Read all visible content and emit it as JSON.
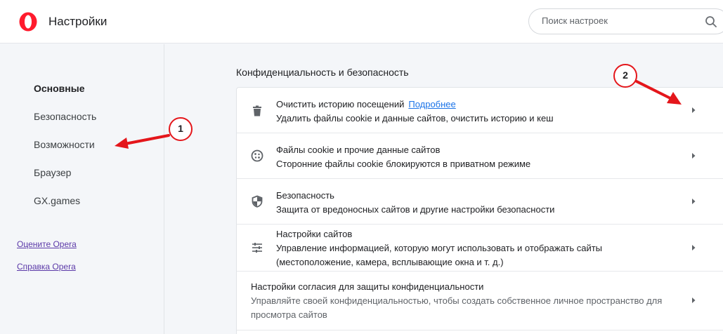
{
  "header": {
    "title": "Настройки",
    "search_placeholder": "Поиск настроек"
  },
  "sidebar": {
    "items": [
      {
        "label": "Основные",
        "active": true
      },
      {
        "label": "Безопасность",
        "active": false
      },
      {
        "label": "Возможности",
        "active": false
      },
      {
        "label": "Браузер",
        "active": false
      },
      {
        "label": "GX.games",
        "active": false
      }
    ],
    "links": [
      "Оцените Opera",
      "Справка Opera"
    ]
  },
  "privacy": {
    "section_title": "Конфиденциальность и безопасность",
    "rows": [
      {
        "icon": "trash-icon",
        "title": "Очистить историю посещений",
        "link": "Подробнее",
        "subtitle": "Удалить файлы cookie и данные сайтов, очистить историю и кеш"
      },
      {
        "icon": "cookie-icon",
        "title": "Файлы cookie и прочие данные сайтов",
        "subtitle": "Сторонние файлы cookie блокируются в приватном режиме"
      },
      {
        "icon": "shield-icon",
        "title": "Безопасность",
        "subtitle": "Защита от вредоносных сайтов и другие настройки безопасности"
      },
      {
        "icon": "sliders-icon",
        "title": "Настройки сайтов",
        "subtitle": "Управление информацией, которую могут использовать и отображать сайты",
        "subtitle2": "(местоположение, камера, всплывающие окна и т. д.)"
      },
      {
        "icon": "",
        "title": "Настройки согласия для защиты конфиденциальности",
        "subtitle": "Управляйте своей конфиденциальностью, чтобы создать собственное личное пространство для",
        "subtitle2": "просмотра сайтов"
      }
    ]
  },
  "annotations": {
    "badge1": "1",
    "badge2": "2"
  },
  "colors": {
    "brand": "#ff1b2d",
    "annotation": "#e4161b",
    "link": "#1a73e8",
    "side_link": "#5b39a8"
  }
}
